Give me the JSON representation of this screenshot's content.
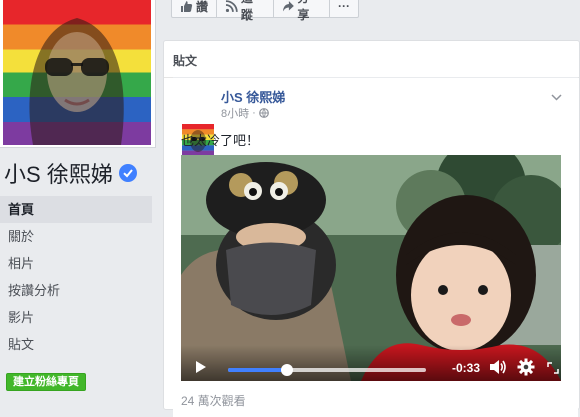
{
  "profile": {
    "name": "小S 徐熙娣",
    "verified": true
  },
  "nav": {
    "items": [
      {
        "label": "首頁",
        "active": true
      },
      {
        "label": "關於",
        "active": false
      },
      {
        "label": "相片",
        "active": false
      },
      {
        "label": "按讚分析",
        "active": false
      },
      {
        "label": "影片",
        "active": false
      },
      {
        "label": "貼文",
        "active": false
      }
    ],
    "create_page_label": "建立粉絲專頁"
  },
  "action_bar": {
    "like_label": "讚",
    "follow_label": "追蹤",
    "share_label": "分享",
    "more_label": "···"
  },
  "posts": {
    "section_title": "貼文",
    "post": {
      "author": "小S 徐熙娣",
      "time": "8小時",
      "privacy_icon": "globe-icon",
      "text": "也太冷了吧！",
      "video": {
        "progress_fraction": 0.3,
        "time_remaining": "-0:33"
      },
      "views": "24 萬次觀看"
    }
  },
  "colors": {
    "link": "#365899",
    "accent": "#4080ff",
    "green": "#42b72a",
    "page_bg": "#e9ebee"
  }
}
